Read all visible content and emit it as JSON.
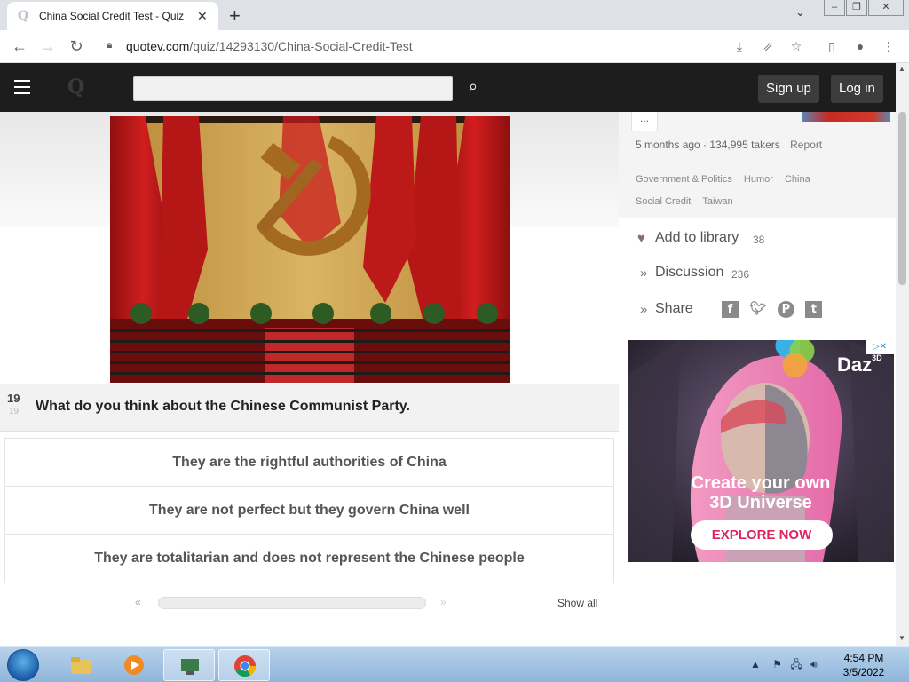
{
  "browser": {
    "tab_title": "China Social Credit Test - Quiz",
    "url_host": "quotev.com",
    "url_path": "/quiz/14293130/China-Social-Credit-Test"
  },
  "site": {
    "logo": "Q",
    "search_placeholder": "",
    "signup_label": "Sign up",
    "login_label": "Log in"
  },
  "question": {
    "number": "19",
    "total": "19",
    "text": "What do you think about the Chinese Communist Party.",
    "answers": [
      "They are the rightful authorities of China",
      "They are not perfect but they govern China well",
      "They are totalitarian and does not represent the Chinese people"
    ]
  },
  "pager": {
    "prev": "«",
    "next": "»",
    "show_all": "Show all"
  },
  "sidebar": {
    "more": "...",
    "meta": "5 months ago · 134,995 takers",
    "report": "Report",
    "tags": [
      "Government & Politics",
      "Humor",
      "China",
      "Social Credit",
      "Taiwan"
    ],
    "add_library": "Add to library",
    "add_library_count": "38",
    "discussion": "Discussion",
    "discussion_count": "236",
    "share": "Share",
    "share_icons": [
      "facebook-icon",
      "twitter-icon",
      "pinterest-icon",
      "tumblr-icon"
    ]
  },
  "ad": {
    "brand": "Daz",
    "brand_sup": "3D",
    "headline_1": "Create your own",
    "headline_2": "3D Universe",
    "cta": "EXPLORE NOW"
  },
  "taskbar": {
    "time": "4:54 PM",
    "date": "3/5/2022"
  },
  "colors": {
    "site_header": "#1d1d1d",
    "ad_cta": "#e0245e",
    "taskbar": "#8fb5da"
  }
}
